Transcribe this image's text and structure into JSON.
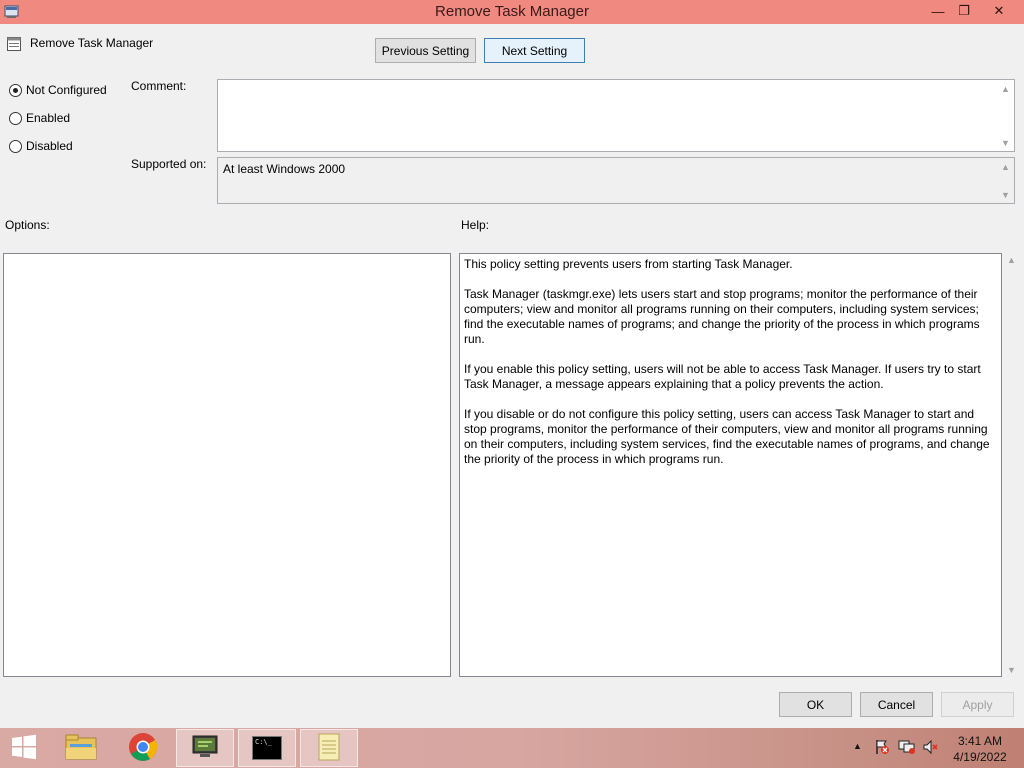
{
  "window": {
    "title": "Remove Task Manager",
    "minimize_glyph": "—",
    "maximize_glyph": "❐",
    "close_glyph": "✕"
  },
  "header": {
    "title": "Remove Task Manager",
    "prev_label": "Previous Setting",
    "next_label": "Next Setting"
  },
  "state": {
    "options": [
      {
        "label": "Not Configured",
        "selected": true
      },
      {
        "label": "Enabled",
        "selected": false
      },
      {
        "label": "Disabled",
        "selected": false
      }
    ]
  },
  "comment": {
    "label": "Comment:",
    "value": ""
  },
  "supported": {
    "label": "Supported on:",
    "value": "At least Windows 2000"
  },
  "options_label": "Options:",
  "help": {
    "label": "Help:",
    "paragraphs": [
      "This policy setting prevents users from starting Task Manager.",
      "Task Manager (taskmgr.exe) lets users start and stop programs; monitor the performance of their computers; view and monitor all programs running on their computers, including system services; find the executable names of programs; and change the priority of the process in which programs run.",
      "If you enable this policy setting, users will not be able to access Task Manager. If users try to start Task Manager, a message appears explaining that a policy prevents the action.",
      "If you disable or do not configure this policy setting, users can access Task Manager to  start and stop programs, monitor the performance of their computers, view and monitor all programs running on their computers, including system services, find the executable names of programs, and change the priority of the process in which programs run."
    ]
  },
  "footer": {
    "ok": "OK",
    "cancel": "Cancel",
    "apply": "Apply"
  },
  "taskbar": {
    "items": [
      "start-icon",
      "file-explorer-icon",
      "chrome-icon",
      "group-policy-icon",
      "command-prompt-icon",
      "notepad-icon"
    ],
    "cmd_text": "C:\\_",
    "time": "3:41 AM",
    "date": "4/19/2022"
  },
  "colors": {
    "titlebar": "#f08a80",
    "taskbar": "#d9a9a4"
  }
}
